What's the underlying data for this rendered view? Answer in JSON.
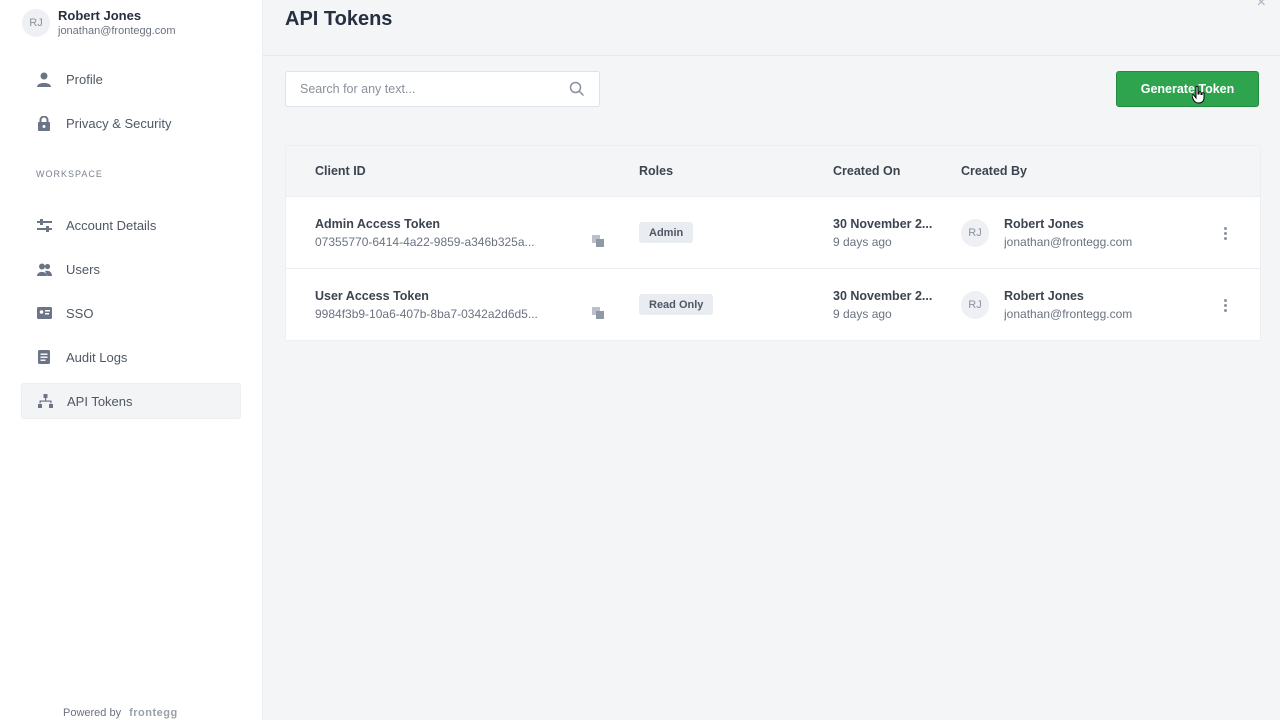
{
  "user": {
    "initials": "RJ",
    "name": "Robert Jones",
    "email": "jonathan@frontegg.com"
  },
  "sidebar": {
    "items": [
      {
        "label": "Profile",
        "icon": "person-icon"
      },
      {
        "label": "Privacy & Security",
        "icon": "lock-icon"
      }
    ],
    "section_label": "WORKSPACE",
    "workspace_items": [
      {
        "label": "Account Details",
        "icon": "sliders-icon"
      },
      {
        "label": "Users",
        "icon": "users-icon"
      },
      {
        "label": "SSO",
        "icon": "sso-icon"
      },
      {
        "label": "Audit Logs",
        "icon": "document-icon"
      },
      {
        "label": "API Tokens",
        "icon": "hierarchy-icon",
        "active": true
      }
    ],
    "powered_by": "Powered by",
    "brand": "frontegg"
  },
  "page": {
    "title": "API Tokens",
    "close_icon": "×"
  },
  "search": {
    "placeholder": "Search for any text..."
  },
  "generate_button": "Generate Token",
  "table": {
    "headers": [
      "Client ID",
      "Roles",
      "Created On",
      "Created By"
    ],
    "rows": [
      {
        "name": "Admin Access Token",
        "client_id": "07355770-6414-4a22-9859-a346b325a...",
        "role": "Admin",
        "created_on": "30 November 2...",
        "created_ago": "9 days ago",
        "creator_initials": "RJ",
        "creator_name": "Robert Jones",
        "creator_email": "jonathan@frontegg.com"
      },
      {
        "name": "User Access Token",
        "client_id": "9984f3b9-10a6-407b-8ba7-0342a2d6d5...",
        "role": "Read Only",
        "created_on": "30 November 2...",
        "created_ago": "9 days ago",
        "creator_initials": "RJ",
        "creator_name": "Robert Jones",
        "creator_email": "jonathan@frontegg.com"
      }
    ]
  },
  "colors": {
    "primary_green": "#2ea44f",
    "sidebar_bg": "#ffffff",
    "main_bg": "#f4f5f7"
  }
}
